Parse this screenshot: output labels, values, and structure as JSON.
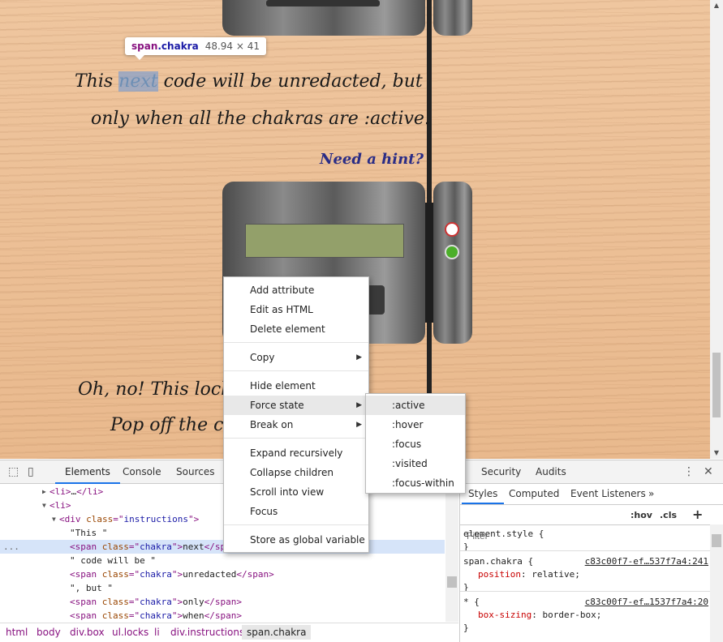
{
  "page": {
    "intro_line1_pre": "This ",
    "intro_chakra": "next",
    "intro_line1_post": " code will be unredacted, but",
    "intro_line2": "only when all the chakras are :active.",
    "hint_link": "Need a hint?",
    "lock_line1": "Oh, no! This lock",
    "lock_line2": "Pop off the c"
  },
  "tooltip": {
    "tag": "span",
    "selector": ".chakra",
    "size": "48.94 × 41"
  },
  "devtools": {
    "tabs": [
      "Elements",
      "Console",
      "Sources",
      "Security",
      "Audits"
    ],
    "active_tab": "Elements",
    "dom_lines": [
      {
        "indent": 52,
        "arrow": "▶",
        "parts": [
          [
            "t-tag",
            "<li>"
          ],
          [
            "t-txt",
            "…"
          ],
          [
            "t-tag",
            "</li>"
          ]
        ]
      },
      {
        "indent": 52,
        "arrow": "▼",
        "parts": [
          [
            "t-tag",
            "<li>"
          ]
        ]
      },
      {
        "indent": 64,
        "arrow": "▼",
        "parts": [
          [
            "t-tag",
            "<div "
          ],
          [
            "t-attr",
            "class"
          ],
          [
            "t-tag",
            "=\""
          ],
          [
            "t-val",
            "instructions"
          ],
          [
            "t-tag",
            "\">"
          ]
        ]
      },
      {
        "indent": 86,
        "arrow": "",
        "parts": [
          [
            "t-txt",
            "\"This \""
          ]
        ]
      },
      {
        "indent": 86,
        "arrow": "",
        "parts": [
          [
            "t-tag",
            "<span "
          ],
          [
            "t-attr",
            "class"
          ],
          [
            "t-tag",
            "=\""
          ],
          [
            "t-val",
            "chakra"
          ],
          [
            "t-tag",
            "\">"
          ],
          [
            "t-txt",
            "next"
          ],
          [
            "t-tag",
            "</sp"
          ]
        ]
      },
      {
        "indent": 86,
        "arrow": "",
        "parts": [
          [
            "t-txt",
            "\" code will be \""
          ]
        ]
      },
      {
        "indent": 86,
        "arrow": "",
        "parts": [
          [
            "t-tag",
            "<span "
          ],
          [
            "t-attr",
            "class"
          ],
          [
            "t-tag",
            "=\""
          ],
          [
            "t-val",
            "chakra"
          ],
          [
            "t-tag",
            "\">"
          ],
          [
            "t-txt",
            "unredacted"
          ],
          [
            "t-tag",
            "</span>"
          ]
        ]
      },
      {
        "indent": 86,
        "arrow": "",
        "parts": [
          [
            "t-txt",
            "\", but \""
          ]
        ]
      },
      {
        "indent": 86,
        "arrow": "",
        "parts": [
          [
            "t-tag",
            "<span "
          ],
          [
            "t-attr",
            "class"
          ],
          [
            "t-tag",
            "=\""
          ],
          [
            "t-val",
            "chakra"
          ],
          [
            "t-tag",
            "\">"
          ],
          [
            "t-txt",
            "only"
          ],
          [
            "t-tag",
            "</span>"
          ]
        ]
      },
      {
        "indent": 86,
        "arrow": "",
        "parts": [
          [
            "t-tag",
            "<span "
          ],
          [
            "t-attr",
            "class"
          ],
          [
            "t-tag",
            "=\""
          ],
          [
            "t-val",
            "chakra"
          ],
          [
            "t-tag",
            "\">"
          ],
          [
            "t-txt",
            "when"
          ],
          [
            "t-tag",
            "</span>"
          ]
        ]
      }
    ],
    "selected_line_marker": "...",
    "breadcrumbs": [
      "html",
      "body",
      "div.box",
      "ul.locks",
      "li",
      "div.instructions",
      "span.chakra"
    ],
    "side_tabs": [
      "Styles",
      "Computed",
      "Event Listeners"
    ],
    "side_more": "»",
    "filter_placeholder": "Filter",
    "hov_label": ":hov",
    "cls_label": ".cls",
    "add_label": "+",
    "rules": [
      {
        "selector": "element.style {",
        "source": "",
        "prop": "",
        "value": "",
        "close": "}"
      },
      {
        "selector": "span.chakra {",
        "source": "c83c00f7-ef…537f7a4:241",
        "prop": "position",
        "value": "relative;",
        "close": "}"
      },
      {
        "selector": "* {",
        "source": "c83c00f7-ef…1537f7a4:20",
        "prop": "box-sizing",
        "value": "border-box;",
        "close": "}"
      }
    ]
  },
  "context_menu": {
    "items": [
      {
        "label": "Add attribute",
        "submenu": false
      },
      {
        "label": "Edit as HTML",
        "submenu": false
      },
      {
        "label": "Delete element",
        "submenu": false
      },
      {
        "label": "Copy",
        "submenu": true
      },
      {
        "label": "Hide element",
        "submenu": false
      },
      {
        "label": "Force state",
        "submenu": true
      },
      {
        "label": "Break on",
        "submenu": true
      },
      {
        "label": "Expand recursively",
        "submenu": false
      },
      {
        "label": "Collapse children",
        "submenu": false
      },
      {
        "label": "Scroll into view",
        "submenu": false
      },
      {
        "label": "Focus",
        "submenu": false
      },
      {
        "label": "Store as global variable",
        "submenu": false
      }
    ],
    "highlighted": "Force state",
    "submenu_items": [
      ":active",
      ":hover",
      ":focus",
      ":visited",
      ":focus-within"
    ],
    "submenu_highlighted": ":active"
  }
}
